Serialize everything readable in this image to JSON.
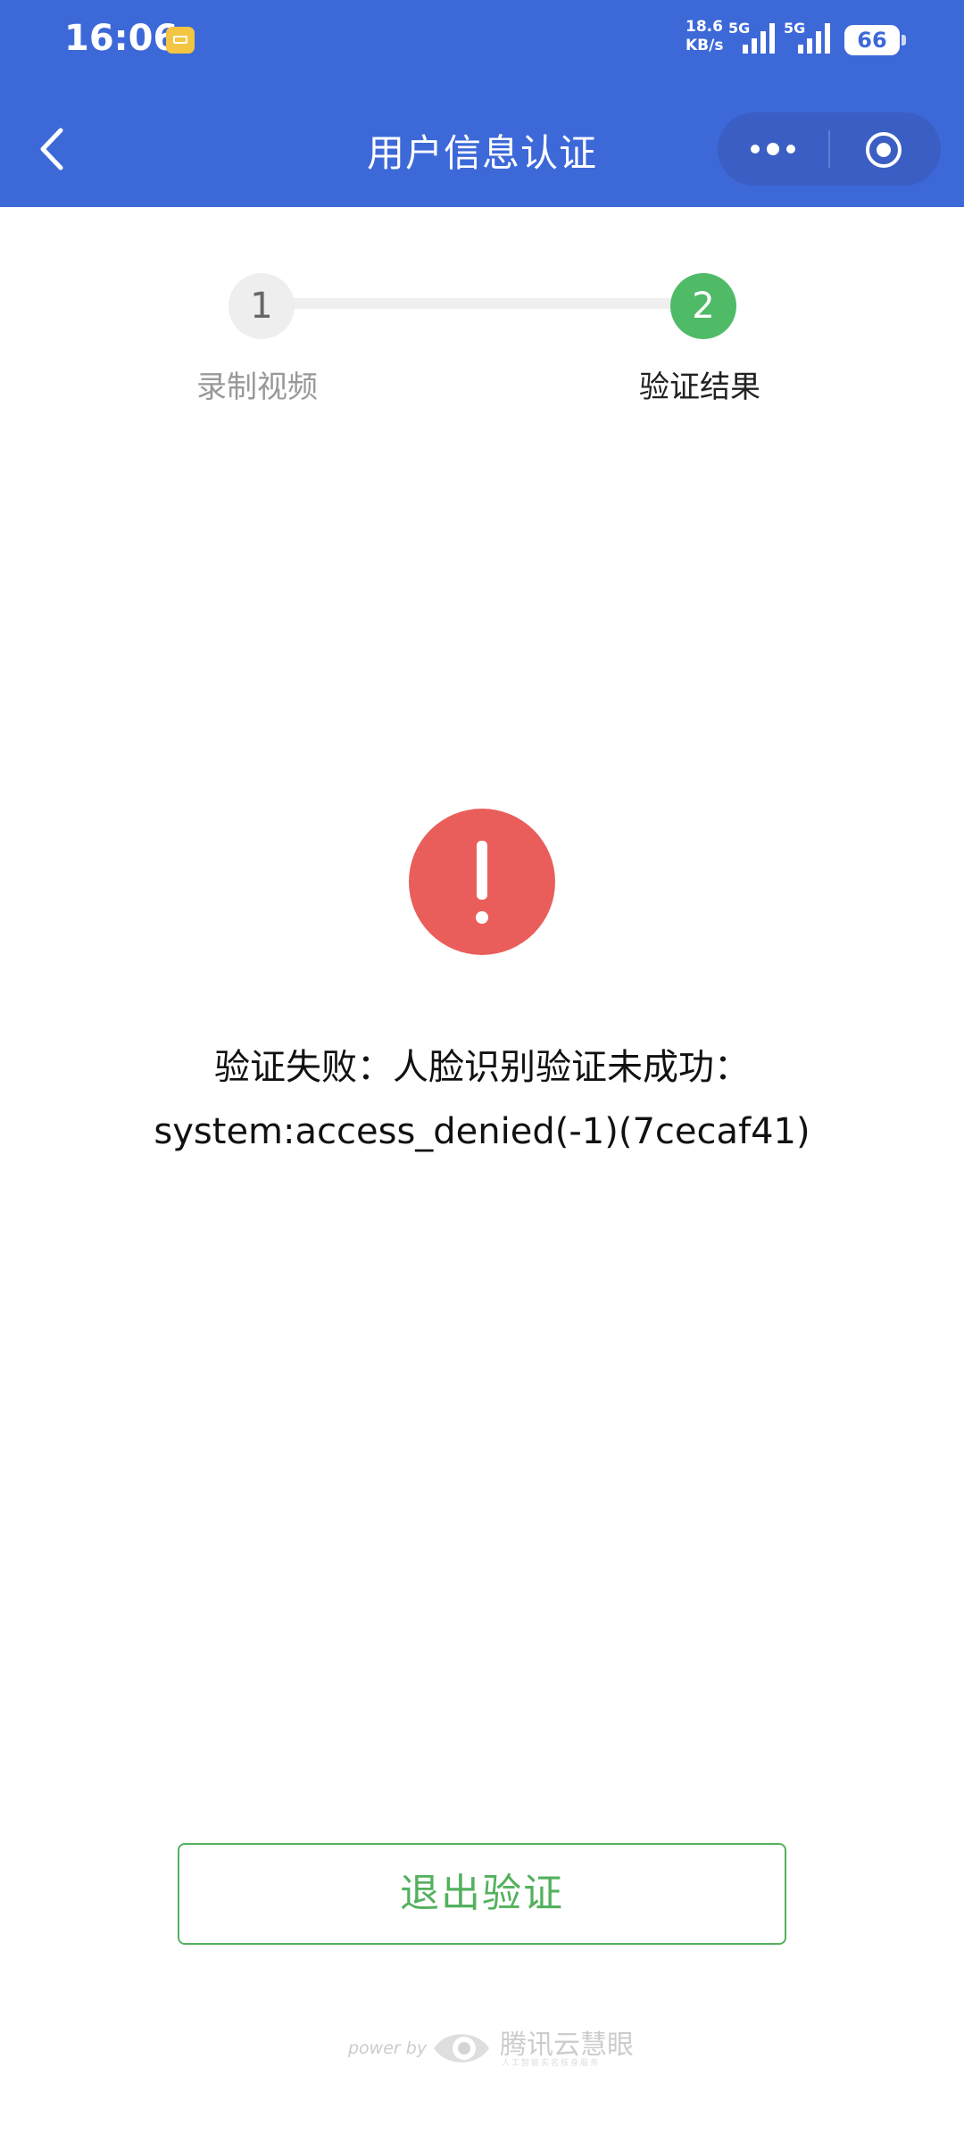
{
  "status_bar": {
    "time": "16:06",
    "net_speed_value": "18.6",
    "net_speed_unit": "KB/s",
    "signal1_label": "5G",
    "signal2_label": "5G",
    "battery": "66"
  },
  "header": {
    "title": "用户信息认证"
  },
  "steps": [
    {
      "number": "1",
      "label": "录制视频",
      "state": "done"
    },
    {
      "number": "2",
      "label": "验证结果",
      "state": "active"
    }
  ],
  "result": {
    "line1": "验证失败：人脸识别验证未成功：",
    "line2": "system:access_denied(-1)(7cecaf41)"
  },
  "exit_button_label": "退出验证",
  "footer": {
    "power_by": "power by",
    "brand": "腾讯云慧眼",
    "brand_sub": "人工智能实名核身服务"
  },
  "colors": {
    "header_bg": "#3d68d8",
    "accent_green": "#53b15d",
    "error_red": "#e95e5b"
  }
}
